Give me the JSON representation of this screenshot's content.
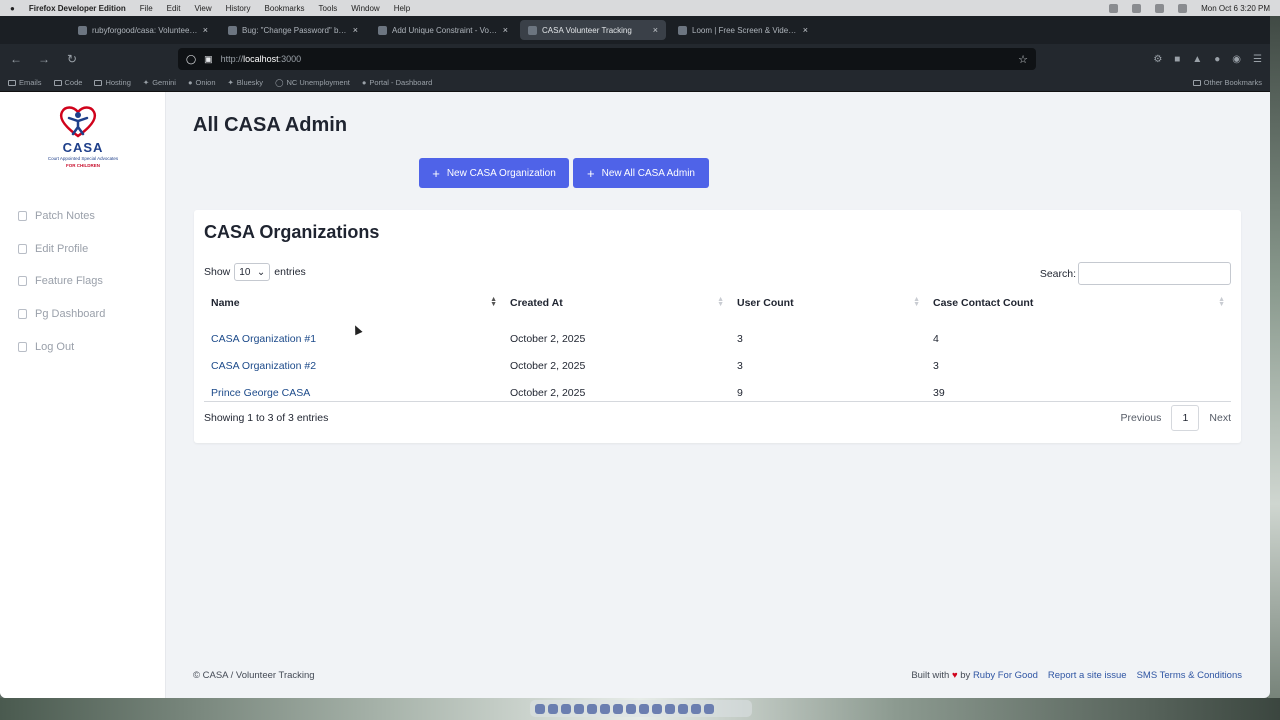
{
  "menubar": {
    "app_name": "Firefox Developer Edition",
    "menus": [
      "File",
      "Edit",
      "View",
      "History",
      "Bookmarks",
      "Tools",
      "Window",
      "Help"
    ],
    "clock": "Mon Oct 6  3:20 PM"
  },
  "browser": {
    "tabs": [
      {
        "label": "rubyforgood/casa: Volunteer m...",
        "active": false
      },
      {
        "label": "Bug: \"Change Password\" butto...",
        "active": false
      },
      {
        "label": "Add Unique Constraint - Volunt...",
        "active": false
      },
      {
        "label": "CASA Volunteer Tracking",
        "active": true
      },
      {
        "label": "Loom | Free Screen & Video Re...",
        "active": false
      }
    ],
    "url_protocol": "http://",
    "url_host": "localhost",
    "url_port": ":3000",
    "bookmarks": [
      "Emails",
      "Code",
      "Hosting",
      "Gemini",
      "Onion",
      "Bluesky",
      "NC Unemployment",
      "Portal - Dashboard"
    ],
    "other_bookmarks": "Other Bookmarks"
  },
  "logo": {
    "name": "CASA",
    "tagline": "Court Appointed Special Advocates",
    "tagline2": "FOR CHILDREN"
  },
  "sidebar": {
    "items": [
      {
        "label": "Patch Notes",
        "icon": "document-icon"
      },
      {
        "label": "Edit Profile",
        "icon": "edit-icon"
      },
      {
        "label": "Feature Flags",
        "icon": "edit-icon"
      },
      {
        "label": "Pg Dashboard",
        "icon": "edit-icon"
      },
      {
        "label": "Log Out",
        "icon": "logout-icon"
      }
    ]
  },
  "main": {
    "title": "All CASA Admin",
    "new_org_button": "New CASA Organization",
    "new_admin_button": "New All CASA Admin"
  },
  "organizations": {
    "title": "CASA Organizations",
    "show_label": "Show",
    "entries_value": "10",
    "entries_label": "entries",
    "search_label": "Search:",
    "columns": [
      "Name",
      "Created At",
      "User Count",
      "Case Contact Count"
    ],
    "rows": [
      {
        "name": "CASA Organization #1",
        "created_at": "October 2, 2025",
        "user_count": "3",
        "case_contact_count": "4"
      },
      {
        "name": "CASA Organization #2",
        "created_at": "October 2, 2025",
        "user_count": "3",
        "case_contact_count": "3"
      },
      {
        "name": "Prince George CASA",
        "created_at": "October 2, 2025",
        "user_count": "9",
        "case_contact_count": "39"
      }
    ],
    "info": "Showing 1 to 3 of 3 entries",
    "pager": {
      "previous": "Previous",
      "current": "1",
      "next": "Next"
    }
  },
  "footer": {
    "left": "© CASA / Volunteer Tracking",
    "built_with": "Built with",
    "by": "by",
    "ruby_for_good": "Ruby For Good",
    "report": "Report a site issue",
    "sms": "SMS Terms & Conditions"
  },
  "colors": {
    "primary": "#4f63e8",
    "link": "#1c4a8a",
    "heart": "#d0021b"
  }
}
